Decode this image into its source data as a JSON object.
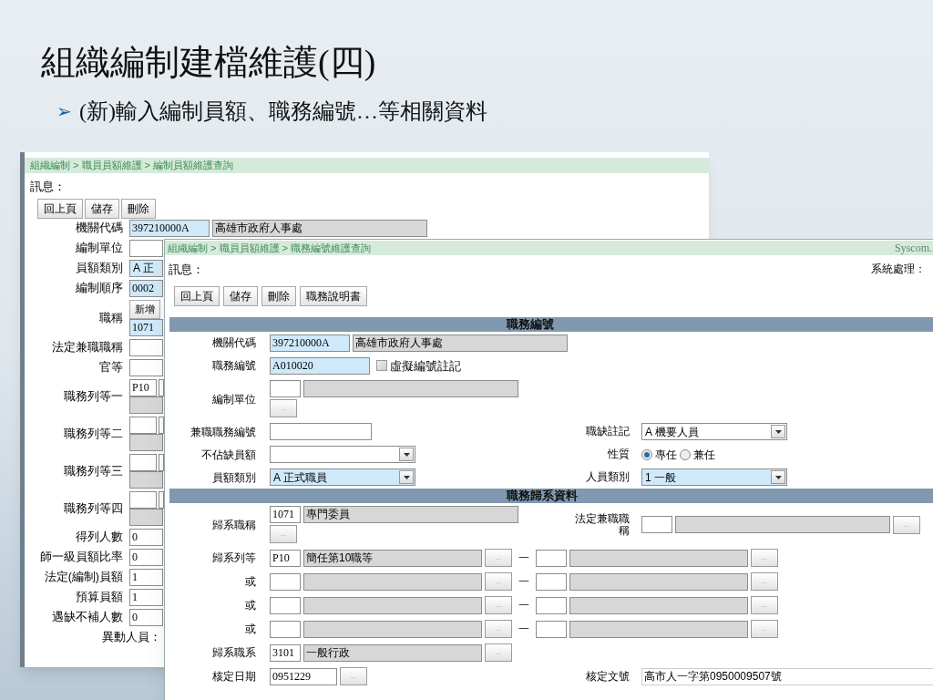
{
  "slide": {
    "title": "組織編制建檔維護(四)",
    "bullet": {
      "marker": "➢",
      "text": "(新)輸入編制員額、職務編號…等相關資料"
    }
  },
  "back_window": {
    "breadcrumb": "組織編制 > 職員員額維護 > 編制員額維護查詢",
    "message_label": "訊息：",
    "buttons": [
      "回上頁",
      "儲存",
      "刪除"
    ],
    "rows": [
      {
        "label": "機關代碼",
        "lines": [
          [
            {
              "kind": "text-blue",
              "value": "397210000A"
            },
            {
              "kind": "gray",
              "value": "高雄市政府人事處"
            }
          ]
        ]
      },
      {
        "label": "編制單位",
        "lines": [
          [
            {
              "kind": "text"
            }
          ]
        ]
      },
      {
        "label": "員額類別",
        "lines": [
          [
            {
              "kind": "select-blue",
              "value": "A 正"
            }
          ]
        ]
      },
      {
        "label": "編制順序",
        "lines": [
          [
            {
              "kind": "text-blue",
              "value": "0002"
            }
          ]
        ]
      },
      {
        "label": "職稱",
        "lines": [
          [
            {
              "kind": "button",
              "label": "新增"
            }
          ],
          [
            {
              "kind": "text-blue",
              "value": "1071"
            }
          ]
        ]
      },
      {
        "label": "法定兼職職稱",
        "lines": [
          [
            {
              "kind": "text"
            }
          ]
        ]
      },
      {
        "label": "官等",
        "lines": [
          [
            {
              "kind": "text"
            }
          ]
        ]
      },
      {
        "label": "職務列等一",
        "lines": [
          [
            {
              "kind": "code",
              "value": "P10"
            },
            {
              "kind": "code"
            }
          ],
          [
            {
              "kind": "gray"
            }
          ]
        ]
      },
      {
        "label": "職務列等二",
        "lines": [
          [
            {
              "kind": "code"
            },
            {
              "kind": "code"
            }
          ],
          [
            {
              "kind": "gray"
            }
          ]
        ]
      },
      {
        "label": "職務列等三",
        "lines": [
          [
            {
              "kind": "code"
            },
            {
              "kind": "code"
            }
          ],
          [
            {
              "kind": "gray"
            }
          ]
        ]
      },
      {
        "label": "職務列等四",
        "lines": [
          [
            {
              "kind": "code"
            },
            {
              "kind": "code"
            }
          ],
          [
            {
              "kind": "gray"
            }
          ]
        ]
      },
      {
        "label": "得列人數",
        "lines": [
          [
            {
              "kind": "text",
              "value": "0"
            }
          ]
        ]
      },
      {
        "label": "師一級員額比率",
        "lines": [
          [
            {
              "kind": "text",
              "value": "0"
            }
          ]
        ]
      },
      {
        "label": "法定(編制)員額",
        "lines": [
          [
            {
              "kind": "text",
              "value": "1"
            }
          ]
        ]
      },
      {
        "label": "預算員額",
        "lines": [
          [
            {
              "kind": "text",
              "value": "1"
            }
          ]
        ]
      },
      {
        "label": "遇缺不補人數",
        "lines": [
          [
            {
              "kind": "text",
              "value": "0"
            }
          ]
        ]
      },
      {
        "label": "異動人員：",
        "lines": []
      }
    ]
  },
  "front_window": {
    "breadcrumb": "組織編制 > 職員員額維護 > 職務編號維護查詢",
    "brand": "Syscom.",
    "message_label": "訊息：",
    "status_label": "系統處理：",
    "buttons": [
      "回上頁",
      "儲存",
      "刪除",
      "職務說明書"
    ],
    "sections": [
      {
        "title": "職務編號",
        "rows": [
          {
            "label": "機關代碼",
            "lines": [
              [
                {
                  "kind": "text-blue",
                  "value": "397210000A"
                },
                {
                  "kind": "gray",
                  "value": "高雄市政府人事處"
                }
              ]
            ]
          },
          {
            "label": "職務編號",
            "lines": [
              [
                {
                  "kind": "text-blue",
                  "value": "A010020"
                },
                {
                  "kind": "checkbox",
                  "label": "虛擬編號註記",
                  "checked": false
                }
              ]
            ]
          },
          {
            "label": "編制單位",
            "lines": [
              [
                {
                  "kind": "code"
                },
                {
                  "kind": "gray"
                }
              ],
              [
                {
                  "kind": "picker",
                  "label": "..."
                }
              ]
            ]
          },
          {
            "label": "兼職職務編號",
            "lines": [
              [
                {
                  "kind": "text"
                }
              ]
            ],
            "right": {
              "label": "職缺註記",
              "lines": [
                [
                  {
                    "kind": "select",
                    "value": "A 機要人員"
                  }
                ]
              ]
            }
          },
          {
            "label": "不佔缺員額",
            "lines": [
              [
                {
                  "kind": "select"
                }
              ]
            ],
            "right": {
              "label": "性質",
              "lines": [
                [
                  {
                    "kind": "radio",
                    "options": [
                      {
                        "label": "專任",
                        "selected": true
                      },
                      {
                        "label": "兼任",
                        "selected": false
                      }
                    ]
                  }
                ]
              ]
            }
          },
          {
            "label": "員額類別",
            "lines": [
              [
                {
                  "kind": "select-blue",
                  "value": "A 正式職員"
                }
              ]
            ],
            "right": {
              "label": "人員類別",
              "lines": [
                [
                  {
                    "kind": "select-blue",
                    "value": "1 一般"
                  }
                ]
              ]
            }
          }
        ]
      },
      {
        "title": "職務歸系資料",
        "rows": [
          {
            "label": "歸系職稱",
            "lines": [
              [
                {
                  "kind": "code",
                  "value": "1071"
                },
                {
                  "kind": "gray",
                  "value": "專門委員"
                }
              ],
              [
                {
                  "kind": "picker",
                  "label": "..."
                }
              ]
            ],
            "right": {
              "label": "法定兼職職稱",
              "lines": [
                [
                  {
                    "kind": "code"
                  },
                  {
                    "kind": "gray"
                  },
                  {
                    "kind": "picker",
                    "label": "..."
                  }
                ]
              ]
            }
          },
          {
            "label": "歸系列等",
            "lines": [
              [
                {
                  "kind": "code",
                  "value": "P10"
                },
                {
                  "kind": "gray",
                  "value": "簡任第10職等"
                },
                {
                  "kind": "picker",
                  "label": "..."
                },
                {
                  "kind": "dash",
                  "label": "一"
                },
                {
                  "kind": "code"
                },
                {
                  "kind": "gray"
                },
                {
                  "kind": "picker",
                  "label": "..."
                }
              ]
            ]
          },
          {
            "label": "或",
            "lines": [
              [
                {
                  "kind": "code"
                },
                {
                  "kind": "gray"
                },
                {
                  "kind": "picker",
                  "label": "..."
                },
                {
                  "kind": "dash",
                  "label": "一"
                },
                {
                  "kind": "code"
                },
                {
                  "kind": "gray"
                },
                {
                  "kind": "picker",
                  "label": "..."
                }
              ]
            ]
          },
          {
            "label": "或",
            "lines": [
              [
                {
                  "kind": "code"
                },
                {
                  "kind": "gray"
                },
                {
                  "kind": "picker",
                  "label": "..."
                },
                {
                  "kind": "dash",
                  "label": "一"
                },
                {
                  "kind": "code"
                },
                {
                  "kind": "gray"
                },
                {
                  "kind": "picker",
                  "label": "..."
                }
              ]
            ]
          },
          {
            "label": "或",
            "lines": [
              [
                {
                  "kind": "code"
                },
                {
                  "kind": "gray"
                },
                {
                  "kind": "picker",
                  "label": "..."
                },
                {
                  "kind": "dash",
                  "label": "一"
                },
                {
                  "kind": "code"
                },
                {
                  "kind": "gray"
                },
                {
                  "kind": "picker",
                  "label": "..."
                }
              ]
            ]
          },
          {
            "label": "歸系職系",
            "lines": [
              [
                {
                  "kind": "code",
                  "value": "3101"
                },
                {
                  "kind": "gray",
                  "value": "一般行政"
                },
                {
                  "kind": "picker",
                  "label": "..."
                }
              ]
            ]
          },
          {
            "label": "核定日期",
            "lines": [
              [
                {
                  "kind": "date",
                  "value": "0951229"
                },
                {
                  "kind": "picker",
                  "label": "..."
                }
              ]
            ],
            "right": {
              "label": "核定文號",
              "lines": [
                [
                  {
                    "kind": "text-wide",
                    "value": "高市人一字第0950009507號"
                  }
                ]
              ]
            }
          }
        ]
      }
    ]
  }
}
